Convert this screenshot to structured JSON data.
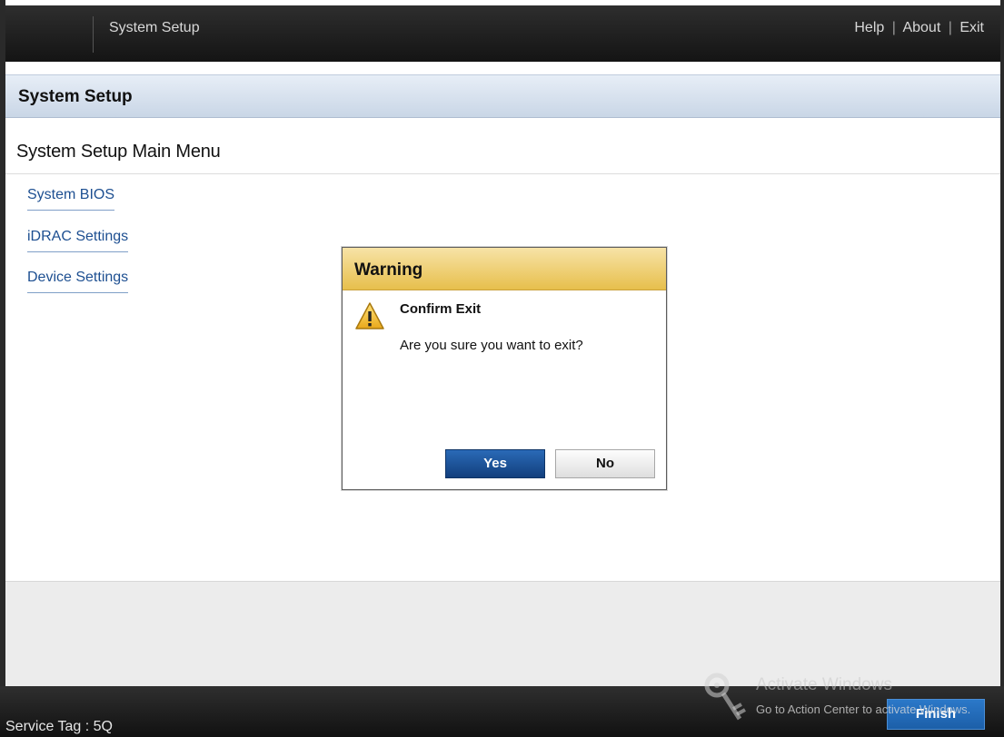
{
  "topbar": {
    "app_title": "System Setup",
    "links": {
      "help": "Help",
      "about": "About",
      "exit": "Exit",
      "separator": "|"
    }
  },
  "page": {
    "title": "System Setup",
    "menu_title": "System Setup Main Menu",
    "menu_items": [
      {
        "label": "System BIOS"
      },
      {
        "label": "iDRAC Settings"
      },
      {
        "label": "Device Settings"
      }
    ]
  },
  "dialog": {
    "title": "Warning",
    "icon": "warning-triangle-icon",
    "heading": "Confirm Exit",
    "message": "Are you sure you want to exit?",
    "yes_label": "Yes",
    "no_label": "No"
  },
  "footer": {
    "service_tag": "Service Tag : 5Q",
    "finish_label": "Finish"
  },
  "watermark": {
    "title": "Activate Windows",
    "subtitle": "Go to Action Center to activate Windows."
  },
  "colors": {
    "topbar": "#1c1c1c",
    "title_band": "#d5e0ee",
    "link": "#1d4f91",
    "dialog_header": "#ecc865",
    "yes_button": "#1c4f91"
  }
}
